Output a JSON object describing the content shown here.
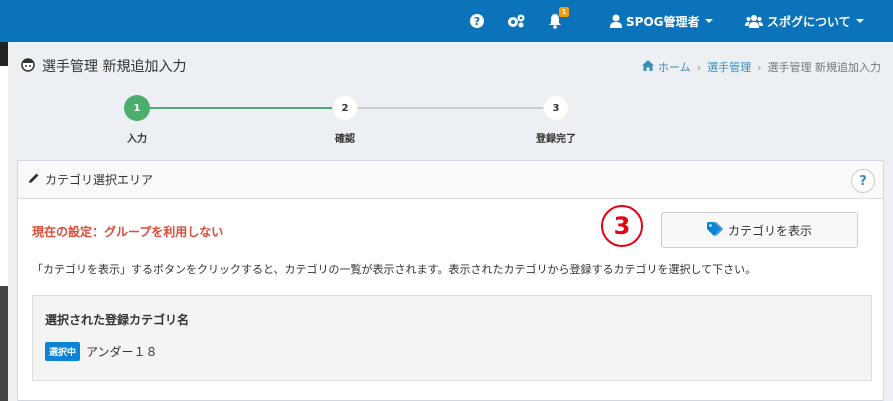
{
  "topbar": {
    "help_icon": "question-circle-icon",
    "settings_icon": "cogs-icon",
    "bell_icon": "bell-icon",
    "notification_count": "1",
    "user_label": "SPOG管理者",
    "about_label": "スポグについて"
  },
  "page": {
    "title": "選手管理 新規追加入力",
    "breadcrumb": {
      "home": "ホーム",
      "parent": "選手管理",
      "current": "選手管理 新規追加入力"
    }
  },
  "stepper": {
    "steps": [
      {
        "number": "1",
        "label": "入力",
        "active": true
      },
      {
        "number": "2",
        "label": "確認",
        "active": false
      },
      {
        "number": "3",
        "label": "登録完了",
        "active": false
      }
    ],
    "active_color": "#4cae6e"
  },
  "panel": {
    "title": "カテゴリ選択エリア",
    "help_label": "?",
    "current_setting": "現在の設定：グループを利用しない",
    "show_category_button": "カテゴリを表示",
    "step_marker": "3",
    "description": "「カテゴリを表示」するボタンをクリックすると、カテゴリの一覧が表示されます。表示されたカテゴリから登録するカテゴリを選択して下さい。",
    "selected": {
      "title": "選択された登録カテゴリ名",
      "badge": "選択中",
      "name": "アンダー１８"
    }
  },
  "colors": {
    "topbar": "#0b73b9",
    "accent": "#3c8dbc",
    "warning_text": "#dd4b39",
    "marker": "#e60012"
  }
}
